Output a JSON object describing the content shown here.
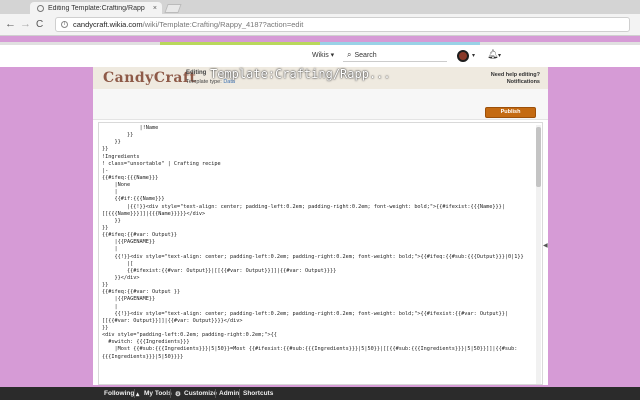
{
  "browser": {
    "tab_title": "Editing Template:Crafting/Rapp",
    "tab_close": "×",
    "url_host": "candycraft.wikia.com",
    "url_path": "/wiki/Template:Crafting/Rappy_4187?action=edit",
    "back_glyph": "←",
    "forward_glyph": "→",
    "reload_glyph": "C"
  },
  "global_nav": {
    "bar_colors": [
      "#e0e0e0",
      "#b9d85c",
      "#9ad2e6",
      "#e0e0e0"
    ],
    "wikis_label": "Wikis",
    "wikis_caret": "▾",
    "search_placeholder": "Search",
    "avatar_caret": "▾",
    "notifications_caret": "▾"
  },
  "editor_header": {
    "logo": "CandyCraft",
    "editing_label": "Editing",
    "page_title": "Template:Crafting/Rapp...",
    "template_type_label": "Template type:",
    "template_type_value": "Data",
    "help_text": "Need help editing?",
    "notifications_text": "Notifications",
    "publish_label": "Publish"
  },
  "code_lines": [
    "            |!Name",
    "        }}",
    "    }}",
    "}}",
    "!Ingredients",
    "! class=\"unsortable\" | Crafting recipe",
    "|-",
    "{{#ifeq:{{{Name}}}",
    "    |None",
    "    |",
    "    {{#if:{{{Name}}}",
    "        |{{!}}<div style=\"text-align: center; padding-left:0.2em; padding-right:0.2em; font-weight: bold;\">{{#ifexist:{{{Name}}}|",
    "[[{{{Name}}}]]|{{{Name}}}}}</div>",
    "    }}",
    "}}",
    "{{#ifeq:{{#var: Output}}",
    "    |{{PAGENAME}}",
    "    |",
    "    {{!}}<div style=\"text-align: center; padding-left:0.2em; padding-right:0.2em; font-weight: bold;\">{{#ifeq:{{#sub:{{{Output}}}|0|1}}",
    "        |[",
    "        {{#ifexist:{{#var: Output}}|[[{{#var: Output}}]]|{{#var: Output}}}}",
    "    }}</div>",
    "}}",
    "{{#ifeq:{{#var: Output }}",
    "    |{{PAGENAME}}",
    "    |",
    "    {{!}}<div style=\"text-align: center; padding-left:0.2em; padding-right:0.2em; font-weight: bold;\">{{#ifexist:{{#var: Output}}|",
    "[[{{#var: Output}}]]|{{#var: Output}}}}</div>",
    "}}",
    "<div style=\"padding-left:0.2em; padding-right:0.2em;\">{{",
    "  #switch: {{{Ingredients}}}",
    "    |Most {{#sub:{{{Ingredients}}}|5|50}}=Most {{#ifexist:{{#sub:{{{Ingredients}}}|5|50}}|[[{{#sub:{{{Ingredients}}}|5|50}}]]|{{#sub:",
    "{{{Ingredients}}}|5|50}}}}"
  ],
  "bottom_toolbar": {
    "items": [
      "Following",
      "My Tools",
      "Customize",
      "Admin",
      "Shortcuts"
    ],
    "mytools_caret": "▴",
    "customize_icon": "gear-icon"
  }
}
